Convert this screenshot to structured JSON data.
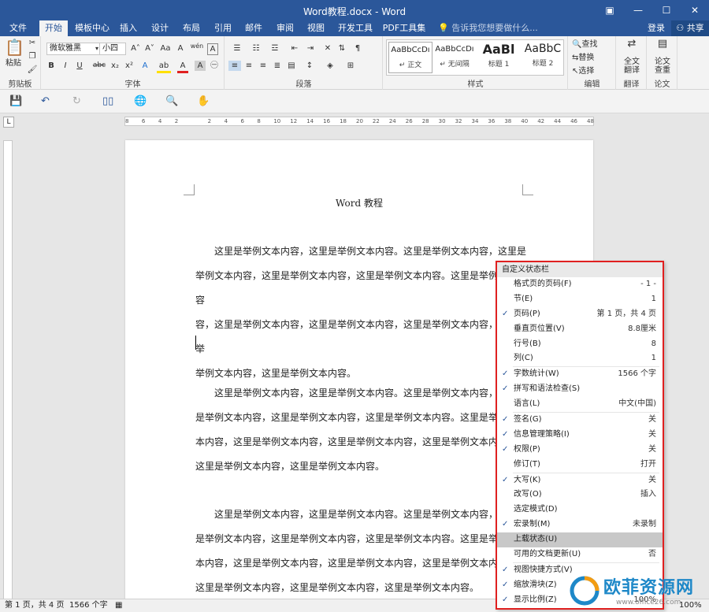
{
  "window": {
    "title": "Word教程.docx - Word",
    "buttons": [
      "▣",
      "—",
      "☐",
      "✕"
    ]
  },
  "tabs": [
    "文件",
    "开始",
    "模板中心",
    "插入",
    "设计",
    "布局",
    "引用",
    "邮件",
    "审阅",
    "视图",
    "开发工具",
    "PDF工具集"
  ],
  "tellme": "告诉我您想要做什么...",
  "login": "登录",
  "share": "共享",
  "ribbon": {
    "clipboard": {
      "paste": "粘贴",
      "label": "剪贴板"
    },
    "font": {
      "name": "微软雅黑",
      "size": "小四",
      "label": "字体",
      "grow": "A˄",
      "shrink": "A˅",
      "case": "Aa",
      "clear": "A",
      "phonetic": "wén",
      "charbox": "A",
      "bold": "B",
      "italic": "I",
      "underline": "U",
      "strike": "abc",
      "sub": "x₂",
      "sup": "x²",
      "effects": "A",
      "highlight": "ab",
      "color": "A",
      "shade": "A",
      "circle": "㊀"
    },
    "paragraph": {
      "label": "段落"
    },
    "styles": {
      "label": "样式",
      "items": [
        {
          "preview": "AaBbCcDı",
          "name": "↵ 正文"
        },
        {
          "preview": "AaBbCcDı",
          "name": "↵ 无间隔"
        },
        {
          "preview": "AaBl",
          "name": "标题 1"
        },
        {
          "preview": "AaBbC",
          "name": "标题 2"
        }
      ]
    },
    "editing": {
      "label": "编辑",
      "find": "查找",
      "replace": "替换",
      "select": "选择"
    },
    "translate": {
      "label": "翻译",
      "full": "全文\n翻译"
    },
    "paper": {
      "label": "论文",
      "check": "论文\n查重"
    }
  },
  "ruler": [
    "8",
    "6",
    "4",
    "2",
    "",
    "2",
    "4",
    "6",
    "8",
    "10",
    "12",
    "14",
    "16",
    "18",
    "20",
    "22",
    "24",
    "26",
    "28",
    "30",
    "32",
    "34",
    "36",
    "38",
    "40",
    "42",
    "44",
    "46",
    "48"
  ],
  "document": {
    "header": "Word 教程",
    "paragraphs": [
      [
        "　　这里是举例文本内容，这里是举例文本内容。这里是举例文本内容，这里是",
        "举例文本内容，这里是举例文本内容，这里是举例文本内容。这里是举例文本内容",
        "容，这里是举例文本内容，这里是举例文本内容，这里是举例文本内容，这里是举",
        "举例文本内容，这里是举例文本内容。"
      ],
      [
        "　　这里是举例文本内容，这里是举例文本内容。这里是举例文本内容，这里",
        "是举例文本内容，这里是举例文本内容，这里是举例文本内容。这里是举例文",
        "本内容，这里是举例文本内容，这里是举例文本内容，这里是举例文本内容，",
        "这里是举例文本内容，这里是举例文本内容。"
      ],
      [
        "　　这里是举例文本内容，这里是举例文本内容。这里是举例文本内容，这里",
        "是举例文本内容，这里是举例文本内容，这里是举例文本内容。这里是举例文",
        "本内容，这里是举例文本内容，这里是举例文本内容，这里是举例文本内容，",
        "这里是举例文本内容，这里是举例文本内容，这里是举例文本内容。"
      ]
    ]
  },
  "status": {
    "page": "第 1 页，共 4 页",
    "words": "1566 个字",
    "zoom": "100%"
  },
  "menu": {
    "title": "自定义状态栏",
    "items": [
      {
        "label": "格式页的页码(F)",
        "value": "- 1 -",
        "checked": false
      },
      {
        "label": "节(E)",
        "value": "1",
        "checked": false
      },
      {
        "label": "页码(P)",
        "value": "第 1 页，共 4 页",
        "checked": true
      },
      {
        "label": "垂直页位置(V)",
        "value": "8.8厘米",
        "checked": false
      },
      {
        "label": "行号(B)",
        "value": "8",
        "checked": false
      },
      {
        "label": "列(C)",
        "value": "1",
        "checked": false,
        "sep": true
      },
      {
        "label": "字数统计(W)",
        "value": "1566 个字",
        "checked": true
      },
      {
        "label": "拼写和语法检查(S)",
        "value": "",
        "checked": true
      },
      {
        "label": "语言(L)",
        "value": "中文(中国)",
        "checked": false,
        "sep": true
      },
      {
        "label": "签名(G)",
        "value": "关",
        "checked": true
      },
      {
        "label": "信息管理策略(I)",
        "value": "关",
        "checked": true
      },
      {
        "label": "权限(P)",
        "value": "关",
        "checked": true
      },
      {
        "label": "修订(T)",
        "value": "打开",
        "checked": false,
        "sep": true
      },
      {
        "label": "大写(K)",
        "value": "关",
        "checked": true
      },
      {
        "label": "改写(O)",
        "value": "插入",
        "checked": false
      },
      {
        "label": "选定模式(D)",
        "value": "",
        "checked": false
      },
      {
        "label": "宏录制(M)",
        "value": "未录制",
        "checked": true
      },
      {
        "label": "上载状态(U)",
        "value": "",
        "checked": false,
        "highlight": true
      },
      {
        "label": "可用的文档更新(U)",
        "value": "否",
        "checked": false,
        "sep": true
      },
      {
        "label": "视图快捷方式(V)",
        "value": "",
        "checked": true
      },
      {
        "label": "缩放滑块(Z)",
        "value": "",
        "checked": true
      },
      {
        "label": "显示比例(Z)",
        "value": "100%",
        "checked": true
      }
    ]
  },
  "watermark": {
    "text": "欧菲资源网",
    "url": "www.office26.com",
    "brand_color": "#1e88c8"
  },
  "colors": {
    "accent": "#2b579a",
    "menu_border": "#e02020"
  }
}
